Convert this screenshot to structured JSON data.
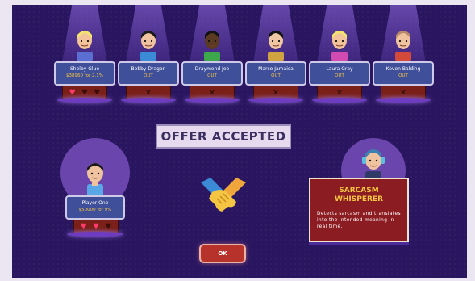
{
  "contestants": [
    {
      "name": "Shelby Glue",
      "offer": "$38960 for 2.1%",
      "status_color": "#f4c543",
      "hearts": [
        "filled",
        "empty",
        "empty"
      ],
      "out": false,
      "skin": "#f3c49a",
      "hair": "#f4e56a",
      "shirt": "#5a6fd1"
    },
    {
      "name": "Bobby Dragon",
      "status": "OUT",
      "out": true,
      "skin": "#f0c3a0",
      "hair": "#1a1a1a",
      "shirt": "#3a8ad6"
    },
    {
      "name": "Draymond Joe",
      "status": "OUT",
      "out": true,
      "skin": "#5b3a22",
      "hair": "#111111",
      "shirt": "#3da84b"
    },
    {
      "name": "Marco Jamaica",
      "status": "OUT",
      "out": true,
      "skin": "#f0c7a3",
      "hair": "#111111",
      "shirt": "#d0a341"
    },
    {
      "name": "Laura Gray",
      "status": "OUT",
      "out": true,
      "skin": "#f3c49a",
      "hair": "#f4e56a",
      "shirt": "#d24bb0"
    },
    {
      "name": "Kevon Balding",
      "status": "OUT",
      "out": true,
      "skin": "#f0c3a0",
      "hair": "#b88a6a",
      "shirt": "#d34a3a"
    }
  ],
  "offer_banner": "OFFER ACCEPTED",
  "player": {
    "name": "Player One",
    "offer": "$50000 for 9%",
    "hearts": [
      "filled",
      "filled",
      "empty"
    ]
  },
  "skill_card": {
    "title_line1": "Sarcasm",
    "title_line2": "Whisperer",
    "description": "Detects sarcasm and translates into the intended meaning in real time."
  },
  "ok_label": "OK",
  "colors": {
    "background": "#2a1660",
    "card": "#3f4f9a",
    "accent_gold": "#f4c543",
    "desk": "#7a2018",
    "heart": "#ff3b6b"
  }
}
